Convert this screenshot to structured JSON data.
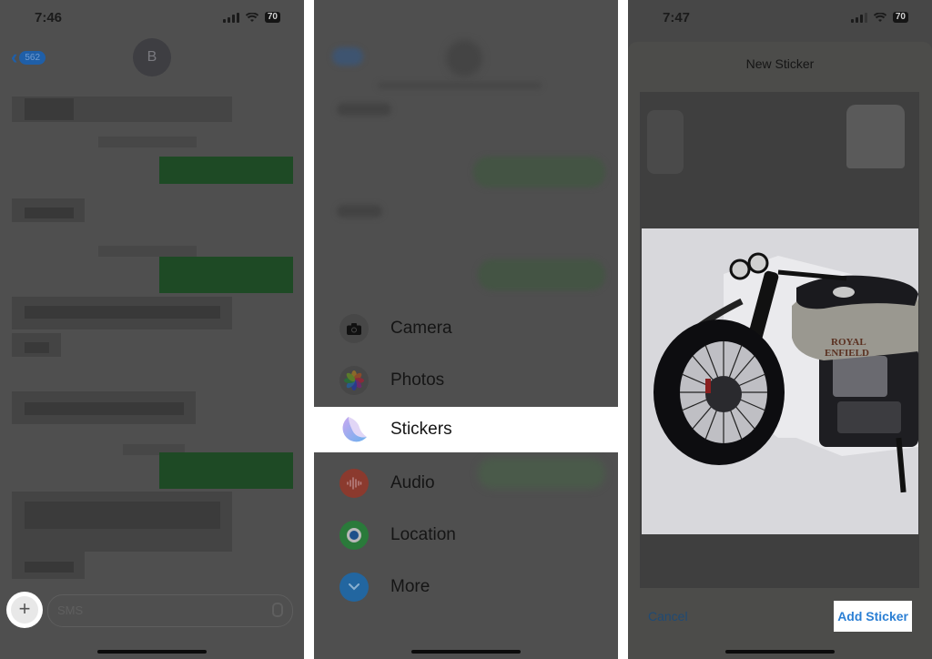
{
  "panels": [
    {
      "status": {
        "time": "7:46",
        "battery": "70"
      },
      "header": {
        "back_count": "562",
        "avatar_initial": "B"
      },
      "composer": {
        "plus_label": "+",
        "placeholder": "SMS"
      }
    },
    {
      "menu": {
        "items": [
          {
            "label": "Camera",
            "icon": "camera-icon",
            "color": "#3a3a3a"
          },
          {
            "label": "Photos",
            "icon": "photos-icon",
            "color": "#3a3a3a"
          },
          {
            "label": "Stickers",
            "icon": "stickers-icon",
            "color": "#ffffff",
            "highlighted": true
          },
          {
            "label": "Audio",
            "icon": "audio-waveform-icon",
            "color": "#8b3a2e"
          },
          {
            "label": "Location",
            "icon": "location-icon",
            "color": "#2a7a3a"
          },
          {
            "label": "More",
            "icon": "chevron-down-icon",
            "color": "#2266a0"
          }
        ]
      }
    },
    {
      "status": {
        "time": "7:47",
        "battery": "70"
      },
      "sheet": {
        "title": "New Sticker",
        "sticker_brand_text": "ROYAL ENFIELD",
        "cancel_label": "Cancel",
        "add_label": "Add Sticker"
      }
    }
  ],
  "colors": {
    "accent": "#2b7fd4",
    "dim_overlay": "#4f4f4f",
    "highlight": "#ffffff"
  }
}
